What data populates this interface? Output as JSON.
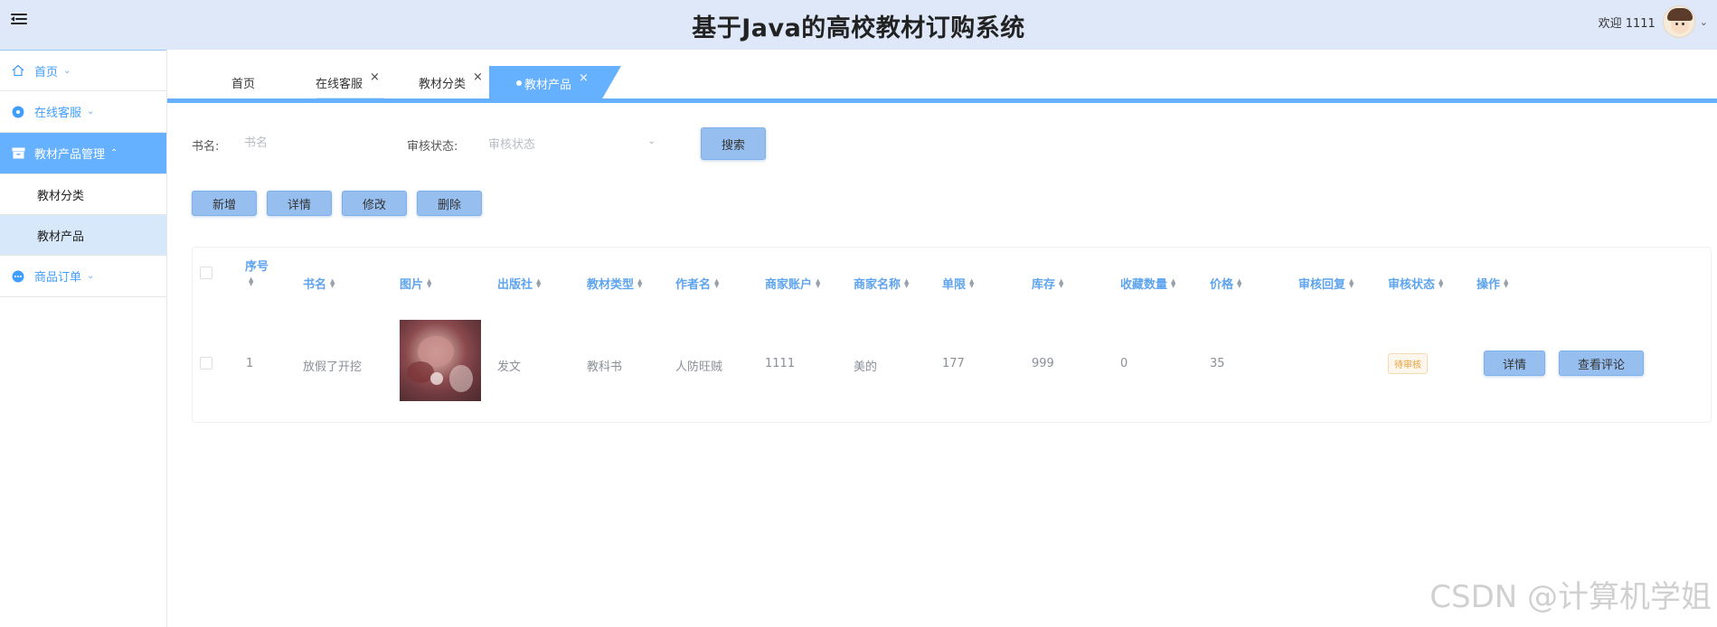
{
  "header": {
    "title": "基于Java的高校教材订购系统",
    "welcome": "欢迎 1111",
    "menu_icon": "hamburger-icon",
    "caret_icon": "chevron-down-icon"
  },
  "sidebar": {
    "items": [
      {
        "label": "首页",
        "icon": "home-icon"
      },
      {
        "label": "在线客服",
        "icon": "chat-icon"
      },
      {
        "label": "教材产品管理",
        "icon": "box-icon",
        "children": [
          "教材分类",
          "教材产品"
        ]
      },
      {
        "label": "商品订单",
        "icon": "order-icon"
      }
    ]
  },
  "tabs": [
    {
      "label": "首页",
      "closable": false
    },
    {
      "label": "在线客服",
      "closable": true
    },
    {
      "label": "教材分类",
      "closable": true
    },
    {
      "label": "教材产品",
      "closable": true,
      "active": true
    }
  ],
  "close_glyph": "×",
  "search": {
    "name_label": "书名:",
    "name_placeholder": "书名",
    "status_label": "审核状态:",
    "status_placeholder": "审核状态",
    "search_button": "搜索"
  },
  "actions": {
    "add": "新增",
    "detail": "详情",
    "edit": "修改",
    "delete": "删除"
  },
  "table": {
    "columns": [
      "序号",
      "书名",
      "图片",
      "出版社",
      "教材类型",
      "作者名",
      "商家账户",
      "商家名称",
      "单限",
      "库存",
      "收藏数量",
      "价格",
      "审核回复",
      "审核状态",
      "操作"
    ],
    "rows": [
      {
        "index": "1",
        "name": "放假了开挖",
        "publisher": "发文",
        "type": "教科书",
        "author": "人防旺贼",
        "account": "1111",
        "merchant": "美的",
        "limit": "177",
        "stock": "999",
        "favorites": "0",
        "price": "35",
        "reply": "",
        "status": "待审核",
        "op_detail": "详情",
        "op_review": "查看评论"
      }
    ]
  },
  "watermark": "CSDN @计算机学姐",
  "colors": {
    "header_bg": "#dfe8f9",
    "accent": "#66b1ff",
    "button": "#96bff0",
    "header_text": "#5fa4ee",
    "badge_text": "#e6a23c"
  }
}
